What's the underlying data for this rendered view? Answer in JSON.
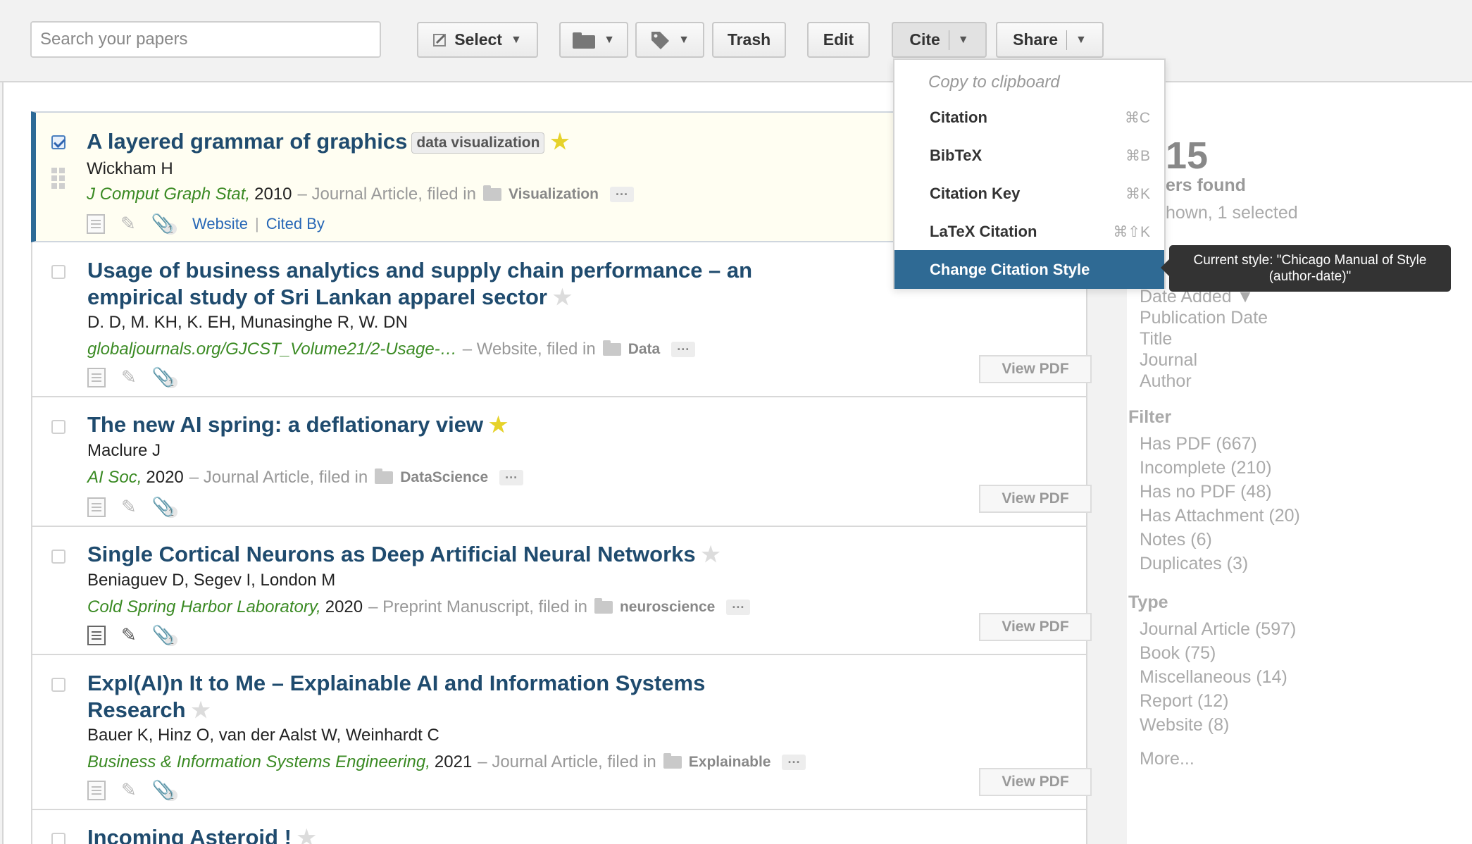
{
  "toolbar": {
    "search_placeholder": "Search your papers",
    "select_label": "Select",
    "trash_label": "Trash",
    "edit_label": "Edit",
    "cite_label": "Cite",
    "share_label": "Share"
  },
  "cite_menu": {
    "header": "Copy to clipboard",
    "items": [
      {
        "label": "Citation",
        "shortcut": "⌘C"
      },
      {
        "label": "BibTeX",
        "shortcut": "⌘B"
      },
      {
        "label": "Citation Key",
        "shortcut": "⌘K"
      },
      {
        "label": "LaTeX Citation",
        "shortcut": "⌘⇧K"
      },
      {
        "label": "Change Citation Style",
        "shortcut": ""
      }
    ],
    "tooltip": "Current style: \"Chicago Manual of Style (author-date)\""
  },
  "papers": [
    {
      "title": "A layered grammar of graphics",
      "tag": "data visualization",
      "starred": true,
      "authors": "Wickham H",
      "journal": "J Comput Graph Stat,",
      "year": "2010",
      "type": "– Journal Article, filed in",
      "folder": "Visualization",
      "attachments": "1",
      "website_label": "Website",
      "cited_by_label": "Cited By",
      "selected": true
    },
    {
      "title_line1": "Usage of business analytics and supply chain performance – an",
      "title_line2": "empirical study of Sri Lankan apparel sector",
      "starred": false,
      "authors": "D. D, M. KH, K. EH, Munasinghe R, W. DN",
      "journal": "globaljournals.org/GJCST_Volume21/2-Usage-…",
      "type": "– Website, filed in",
      "folder": "Data",
      "attachments": "1",
      "view_pdf": "View PDF"
    },
    {
      "title": "The new AI spring: a deflationary view",
      "starred": true,
      "authors": "Maclure J",
      "journal": "AI Soc,",
      "year": "2020",
      "type": "– Journal Article, filed in",
      "folder": "DataScience",
      "attachments": "1",
      "view_pdf": "View PDF"
    },
    {
      "title": "Single Cortical Neurons as Deep Artificial Neural Networks",
      "starred": false,
      "authors": "Beniaguev D, Segev I, London M",
      "journal": "Cold Spring Harbor Laboratory,",
      "year": "2020",
      "type": "– Preprint Manuscript, filed in",
      "folder": "neuroscience",
      "attachments": "1",
      "view_pdf": "View PDF"
    },
    {
      "title_line1": "Expl(AI)n It to Me – Explainable AI and Information Systems",
      "title_line2": "Research",
      "starred": false,
      "authors": "Bauer K, Hinz O, van der Aalst W, Weinhardt C",
      "journal": "Business & Information Systems Engineering,",
      "year": "2021",
      "type": "– Journal Article, filed in",
      "folder": "Explainable",
      "attachments": "1",
      "view_pdf": "View PDF"
    },
    {
      "title": "Incoming Asteroid !",
      "starred": false
    }
  ],
  "sidebar": {
    "count_partial": "15",
    "found_partial": "ers found",
    "shown_partial": "hown, 1 selected",
    "sort_items": [
      "Date Added ▼",
      "Publication Date",
      "Title",
      "Journal",
      "Author"
    ],
    "filter_heading": "Filter",
    "filters": [
      "Has PDF (667)",
      "Incomplete (210)",
      "Has no PDF (48)",
      "Has Attachment (20)",
      "Notes (6)",
      "Duplicates (3)"
    ],
    "type_heading": "Type",
    "types": [
      "Journal Article (597)",
      "Book (75)",
      "Miscellaneous (14)",
      "Report (12)",
      "Website (8)"
    ],
    "more_label": "More..."
  },
  "colors": {
    "title_blue": "#1f4b6e",
    "journal_green": "#3a8a23",
    "star_yellow": "#e6d22a",
    "menu_active": "#2f6a94",
    "selected_bar": "#2d6a96"
  }
}
